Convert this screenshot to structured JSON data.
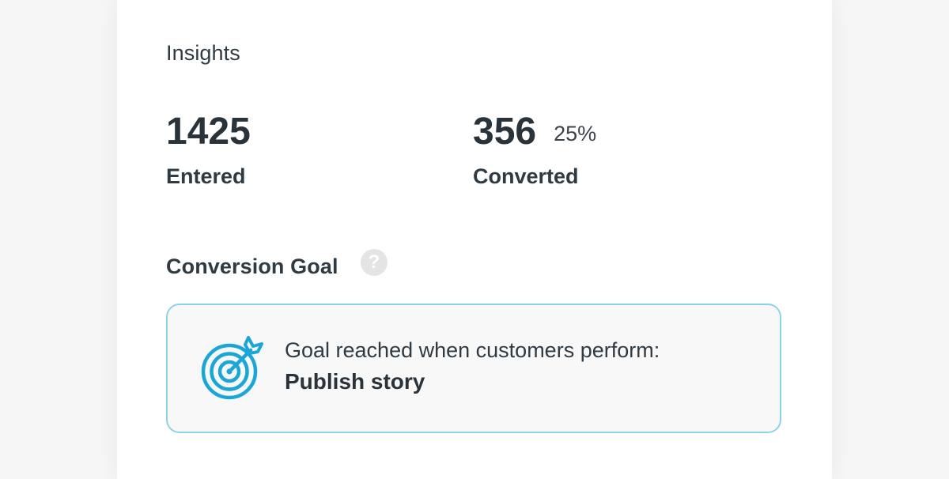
{
  "insights": {
    "title": "Insights",
    "entered": {
      "value": "1425",
      "label": "Entered"
    },
    "converted": {
      "value": "356",
      "percent": "25%",
      "label": "Converted"
    }
  },
  "conversion_goal": {
    "title": "Conversion Goal",
    "help_icon": "question-circle-icon",
    "icon": "target-arrow-icon",
    "caption": "Goal reached when customers perform:",
    "action": "Publish story"
  },
  "colors": {
    "accent": "#1aa6d6",
    "goal_border": "#8dd3e6",
    "goal_background": "#f8f8f8",
    "text": "#2f3a43"
  }
}
